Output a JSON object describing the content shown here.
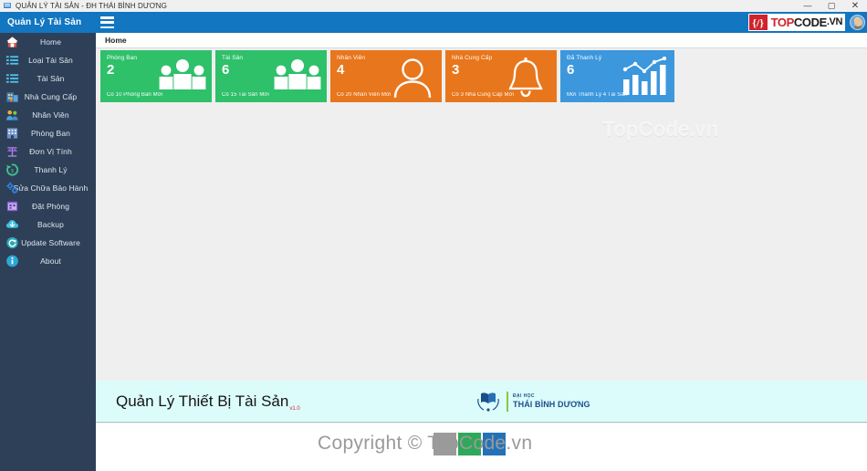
{
  "window": {
    "title": "QUẢN LÝ TÀI SẢN - ĐH THÁI BÌNH DƯƠNG",
    "minimize": "—",
    "maximize": "▢",
    "close": "✕"
  },
  "appbar": {
    "brand": "Quản Lý Tài Sản",
    "menu_icon": "hamburger-icon",
    "logo": {
      "mark": "{/}",
      "word_top": "TOP",
      "word_code": "CODE",
      "word_tld": ".VN"
    },
    "avatar": "user-avatar"
  },
  "sidebar": {
    "items": [
      {
        "label": "Home",
        "icon": "home-icon",
        "active": true
      },
      {
        "label": "Loại Tài Sản",
        "icon": "list-icon",
        "active": false
      },
      {
        "label": "Tài Sản",
        "icon": "list-icon",
        "active": false
      },
      {
        "label": "Nhà Cung Cấp",
        "icon": "supplier-icon",
        "active": false
      },
      {
        "label": "Nhân Viên",
        "icon": "people-icon",
        "active": false
      },
      {
        "label": "Phòng Ban",
        "icon": "building-icon",
        "active": false
      },
      {
        "label": "Đơn Vị Tính",
        "icon": "scales-icon",
        "active": false
      },
      {
        "label": "Thanh Lý",
        "icon": "refresh-icon",
        "active": false
      },
      {
        "label": "Sửa Chữa Bảo Hành",
        "icon": "gears-icon",
        "active": false
      },
      {
        "label": "Đặt Phòng",
        "icon": "calendar-icon",
        "active": false
      },
      {
        "label": "Backup",
        "icon": "cloud-icon",
        "active": false
      },
      {
        "label": "Update Software",
        "icon": "update-icon",
        "active": false
      },
      {
        "label": "About",
        "icon": "info-icon",
        "active": false
      }
    ]
  },
  "content": {
    "breadcrumb": "Home",
    "tiles": [
      {
        "title": "Phòng Ban",
        "value": "2",
        "subtitle": "Có 10 Phòng Ban Mới",
        "color": "#2fc06a",
        "art": "people-art"
      },
      {
        "title": "Tài Sản",
        "value": "6",
        "subtitle": "Có 15 Tài Sản Mới",
        "color": "#2fc06a",
        "art": "people-art"
      },
      {
        "title": "Nhân Viên",
        "value": "4",
        "subtitle": "Có 20 Nhân Viên Mới",
        "color": "#e8761c",
        "art": "person-art"
      },
      {
        "title": "Nhà Cung Cấp",
        "value": "3",
        "subtitle": "Có 3 Nhà Cung Cấp Mới",
        "color": "#e8761c",
        "art": "bell-art"
      },
      {
        "title": "Đã Thanh Lý",
        "value": "6",
        "subtitle": "Mới Thanh Lý 4 Tài Sản",
        "color": "#3c97dd",
        "art": "chart-art"
      }
    ],
    "footer": {
      "app_title": "Quản Lý Thiết Bị Tài Sản",
      "version": "v1.0",
      "university_small": "ĐẠI HỌC",
      "university_large": "THÁI BÌNH DƯƠNG"
    }
  },
  "watermarks": {
    "center": "TopCode.vn",
    "bottom": "Copyright © TopCode.vn",
    "bottom_label": "Copyright © TopCode.vn"
  },
  "colors": {
    "appbar": "#1276c1",
    "sidebar": "#2e4057",
    "green": "#2fc06a",
    "orange": "#e8761c",
    "blue": "#3c97dd",
    "footer_band": "#dcfcfc"
  }
}
